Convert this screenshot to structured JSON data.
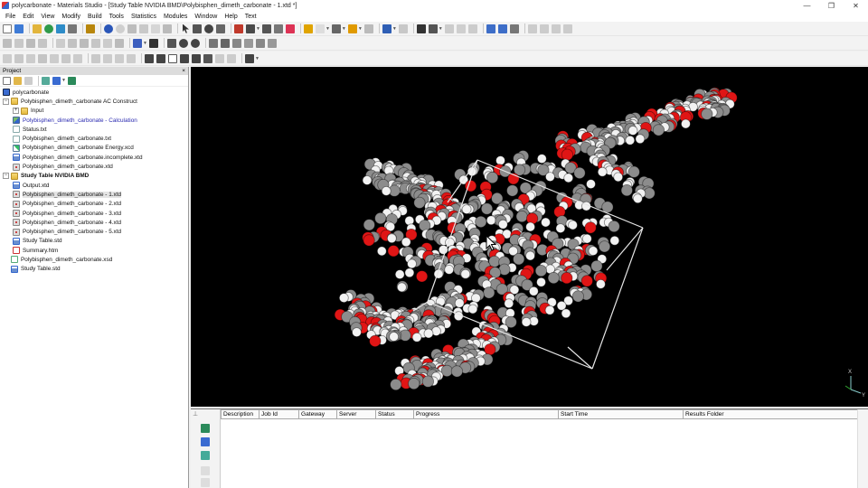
{
  "window": {
    "title": "polycarbonate - Materials Studio - [Study Table NVIDIA BMD\\Polybisphen_dimeth_carbonate - 1.xtd *]",
    "minimize": "—",
    "restore": "❐",
    "close": "✕"
  },
  "menu": [
    "File",
    "Edit",
    "View",
    "Modify",
    "Build",
    "Tools",
    "Statistics",
    "Modules",
    "Window",
    "Help",
    "Text"
  ],
  "project_panel": {
    "title": "Project",
    "close": "×",
    "tree": [
      {
        "label": "polycarbonate",
        "icon": "project-icon",
        "indent": 0,
        "expander": "",
        "style": "normal"
      },
      {
        "label": "Polybisphen_dimeth_carbonate AC Construct",
        "icon": "folder-icon",
        "indent": 0,
        "expander": "−",
        "style": "normal"
      },
      {
        "label": "Input",
        "icon": "folder-icon",
        "indent": 1,
        "expander": "+",
        "style": "normal"
      },
      {
        "label": "Polybisphen_dimeth_carbonate - Calculation",
        "icon": "calculation-icon",
        "indent": 1,
        "expander": "",
        "style": "blue"
      },
      {
        "label": "Status.txt",
        "icon": "text-doc-icon",
        "indent": 1,
        "expander": "",
        "style": "normal"
      },
      {
        "label": "Polybisphen_dimeth_carbonate.txt",
        "icon": "text-doc-icon",
        "indent": 1,
        "expander": "",
        "style": "normal"
      },
      {
        "label": "Polybisphen_dimeth_carbonate Energy.xcd",
        "icon": "chart-doc-icon",
        "indent": 1,
        "expander": "",
        "style": "normal"
      },
      {
        "label": "Polybisphen_dimeth_carbonate.incomplete.xtd",
        "icon": "study-table-icon",
        "indent": 1,
        "expander": "",
        "style": "normal"
      },
      {
        "label": "Polybisphen_dimeth_carbonate.xtd",
        "icon": "trajectory-icon",
        "indent": 1,
        "expander": "",
        "style": "normal"
      },
      {
        "label": "Study Table NVIDIA BMD",
        "icon": "folder-icon",
        "indent": 0,
        "expander": "−",
        "style": "bold"
      },
      {
        "label": "Output.xtd",
        "icon": "study-table-icon",
        "indent": 1,
        "expander": "",
        "style": "normal"
      },
      {
        "label": "Polybisphen_dimeth_carbonate - 1.xtd",
        "icon": "trajectory-icon",
        "indent": 1,
        "expander": "",
        "style": "selected"
      },
      {
        "label": "Polybisphen_dimeth_carbonate - 2.xtd",
        "icon": "trajectory-icon",
        "indent": 1,
        "expander": "",
        "style": "normal"
      },
      {
        "label": "Polybisphen_dimeth_carbonate - 3.xtd",
        "icon": "trajectory-icon",
        "indent": 1,
        "expander": "",
        "style": "normal"
      },
      {
        "label": "Polybisphen_dimeth_carbonate - 4.xtd",
        "icon": "trajectory-icon",
        "indent": 1,
        "expander": "",
        "style": "normal"
      },
      {
        "label": "Polybisphen_dimeth_carbonate - 5.xtd",
        "icon": "trajectory-icon",
        "indent": 1,
        "expander": "",
        "style": "normal"
      },
      {
        "label": "Study Table.std",
        "icon": "study-table-icon",
        "indent": 1,
        "expander": "",
        "style": "normal"
      },
      {
        "label": "Summary.htm",
        "icon": "html-doc-icon",
        "indent": 1,
        "expander": "",
        "style": "normal"
      },
      {
        "label": "Polybisphen_dimeth_carbonate.xsd",
        "icon": "structure-doc-icon",
        "indent": 0,
        "expander": "",
        "style": "normal"
      },
      {
        "label": "Study Table.std",
        "icon": "study-table-icon",
        "indent": 0,
        "expander": "",
        "style": "normal"
      }
    ]
  },
  "viewer": {
    "axis_labels": {
      "x": "X",
      "y": "Y"
    },
    "colors": {
      "background": "#000000",
      "carbon": "#8c8c8c",
      "hydrogen": "#f2f2f2",
      "oxygen": "#e01515",
      "cell": "#e6e6e6"
    }
  },
  "jobs": {
    "columns": [
      "Description",
      "Job Id",
      "Gateway",
      "Server",
      "Status",
      "Progress",
      "Start Time",
      "Results Folder"
    ],
    "pin": "⊥"
  }
}
